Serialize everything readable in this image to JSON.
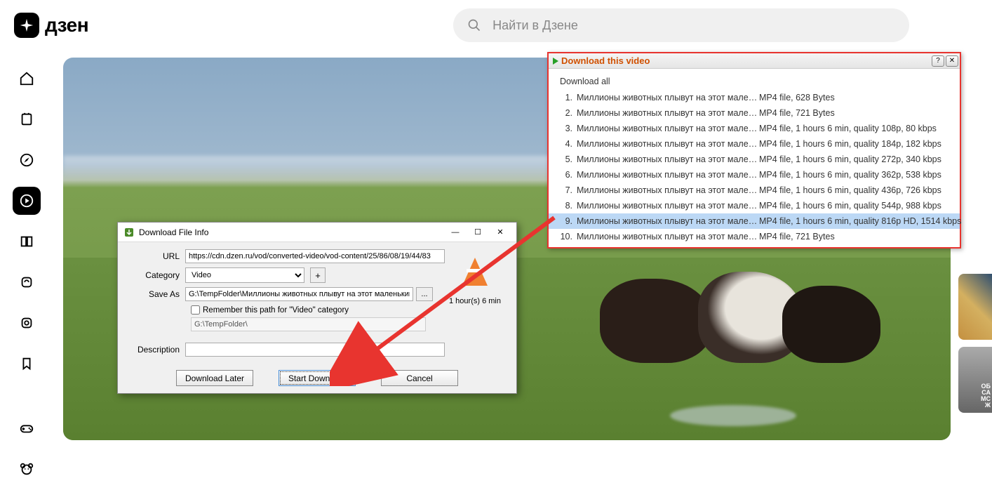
{
  "header": {
    "logo_text": "дзен",
    "search_placeholder": "Найти в Дзене"
  },
  "idm_popup": {
    "title": "Download this video",
    "download_all": "Download all",
    "items": [
      {
        "num": "1.",
        "name": "Миллионы животных плывут на этот маленьк...",
        "details": "MP4 file, 628 Bytes"
      },
      {
        "num": "2.",
        "name": "Миллионы животных плывут на этот маленьк...",
        "details": "MP4 file, 721 Bytes"
      },
      {
        "num": "3.",
        "name": "Миллионы животных плывут на этот маленьк...",
        "details": "MP4 file, 1 hours 6 min, quality 108p, 80 kbps"
      },
      {
        "num": "4.",
        "name": "Миллионы животных плывут на этот маленьк...",
        "details": "MP4 file, 1 hours 6 min, quality 184p, 182 kbps"
      },
      {
        "num": "5.",
        "name": "Миллионы животных плывут на этот маленьк...",
        "details": "MP4 file, 1 hours 6 min, quality 272p, 340 kbps"
      },
      {
        "num": "6.",
        "name": "Миллионы животных плывут на этот маленьк...",
        "details": "MP4 file, 1 hours 6 min, quality 362p, 538 kbps"
      },
      {
        "num": "7.",
        "name": "Миллионы животных плывут на этот маленьк...",
        "details": "MP4 file, 1 hours 6 min, quality 436p, 726 kbps"
      },
      {
        "num": "8.",
        "name": "Миллионы животных плывут на этот маленьк...",
        "details": "MP4 file, 1 hours 6 min, quality 544p, 988 kbps"
      },
      {
        "num": "9.",
        "name": "Миллионы животных плывут на этот маленьк...",
        "details": "MP4 file, 1 hours 6 min, quality 816p HD, 1514 kbps"
      },
      {
        "num": "10.",
        "name": "Миллионы животных плывут на этот маленьк...",
        "details": "MP4 file, 721 Bytes"
      }
    ],
    "highlighted_index": 8
  },
  "idm_dialog": {
    "title": "Download File Info",
    "labels": {
      "url": "URL",
      "category": "Category",
      "save_as": "Save As",
      "description": "Description"
    },
    "url": "https://cdn.dzen.ru/vod/converted-video/vod-content/25/86/08/19/44/83",
    "category": "Video",
    "save_as": "G:\\TempFolder\\Миллионы животных плывут на этот маленький",
    "remember": "Remember this path for \"Video\" category",
    "readonly_path": "G:\\TempFolder\\",
    "duration": "1 hour(s) 6 min",
    "buttons": {
      "later": "Download Later",
      "start": "Start Download",
      "cancel": "Cancel"
    }
  },
  "sys": {
    "min": "—",
    "max": "☐",
    "close": "✕",
    "help": "?",
    "x": "✕",
    "plus": "+",
    "browse": "..."
  }
}
